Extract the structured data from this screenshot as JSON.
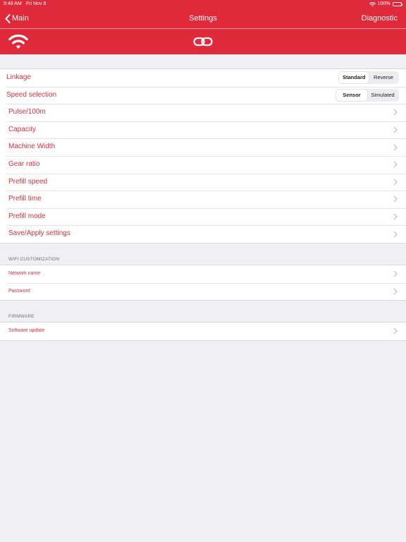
{
  "status_bar": {
    "time": "9:48 AM",
    "date": "Fri Nov 8",
    "battery": "100%"
  },
  "nav": {
    "back_label": "Main",
    "title": "Settings",
    "right_label": "Diagnostic"
  },
  "icons": {
    "connection": "wifi-icon",
    "link": "chain-link-icon"
  },
  "colors": {
    "accent": "#e0293a",
    "label_red": "#d8313f",
    "background": "#efeff4"
  },
  "settings": {
    "linkage": {
      "label": "Linkage",
      "options": [
        "Standard",
        "Reverse"
      ],
      "selected": "Standard"
    },
    "speed_selection": {
      "label": "Speed selection",
      "options": [
        "Sensor",
        "Simulated"
      ],
      "selected": "Sensor"
    },
    "items": [
      "Pulse/100m",
      "Capacity",
      "Machine Width",
      "Gear ratio",
      "Prefill speed",
      "Prefill time",
      "Prefill mode",
      "Save/Apply settings"
    ]
  },
  "wifi_section": {
    "header": "WIFI CUSTOMIZATION",
    "items": [
      "Network name",
      "Password"
    ]
  },
  "firmware_section": {
    "header": "FIRMWARE",
    "items": [
      "Software update"
    ]
  }
}
